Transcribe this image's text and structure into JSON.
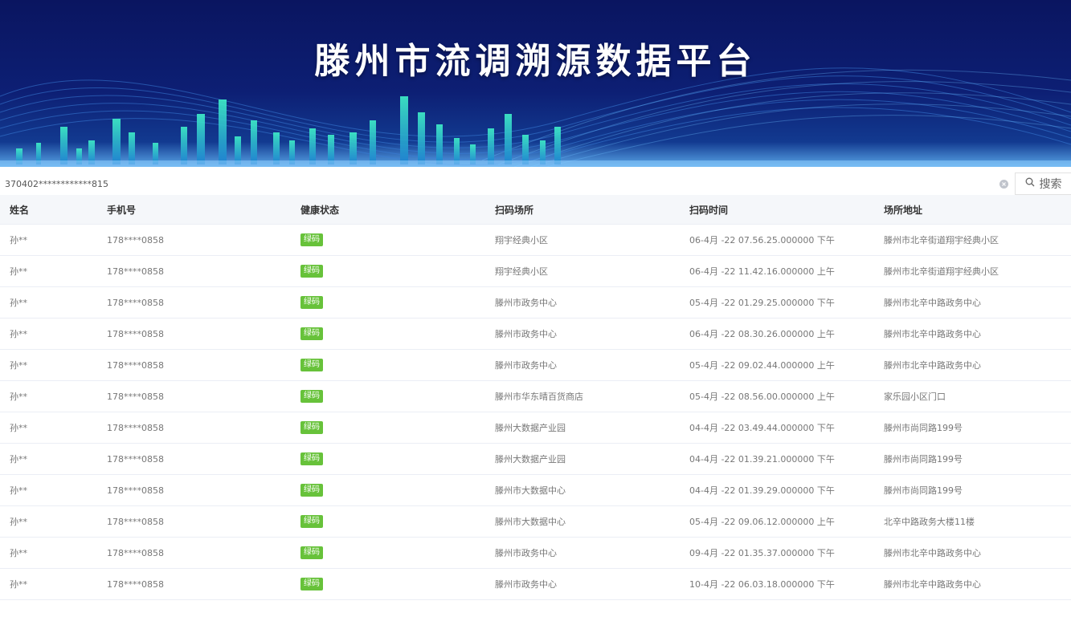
{
  "banner": {
    "title": "滕州市流调溯源数据平台"
  },
  "search": {
    "value": "370402************815",
    "button_label": "搜索"
  },
  "table": {
    "columns": [
      "姓名",
      "手机号",
      "健康状态",
      "扫码场所",
      "扫码时间",
      "场所地址"
    ],
    "rows": [
      {
        "name": "孙**",
        "phone": "178****0858",
        "status": "绿码",
        "place": "翔宇经典小区",
        "time": "06-4月 -22 07.56.25.000000 下午",
        "address": "滕州市北辛街道翔宇经典小区"
      },
      {
        "name": "孙**",
        "phone": "178****0858",
        "status": "绿码",
        "place": "翔宇经典小区",
        "time": "06-4月 -22 11.42.16.000000 上午",
        "address": "滕州市北辛街道翔宇经典小区"
      },
      {
        "name": "孙**",
        "phone": "178****0858",
        "status": "绿码",
        "place": "滕州市政务中心",
        "time": "05-4月 -22 01.29.25.000000 下午",
        "address": "滕州市北辛中路政务中心"
      },
      {
        "name": "孙**",
        "phone": "178****0858",
        "status": "绿码",
        "place": "滕州市政务中心",
        "time": "06-4月 -22 08.30.26.000000 上午",
        "address": "滕州市北辛中路政务中心"
      },
      {
        "name": "孙**",
        "phone": "178****0858",
        "status": "绿码",
        "place": "滕州市政务中心",
        "time": "05-4月 -22 09.02.44.000000 上午",
        "address": "滕州市北辛中路政务中心"
      },
      {
        "name": "孙**",
        "phone": "178****0858",
        "status": "绿码",
        "place": "滕州市华东晴百货商店",
        "time": "05-4月 -22 08.56.00.000000 上午",
        "address": "家乐园小区门口"
      },
      {
        "name": "孙**",
        "phone": "178****0858",
        "status": "绿码",
        "place": "滕州大数据产业园",
        "time": "04-4月 -22 03.49.44.000000 下午",
        "address": "滕州市尚同路199号"
      },
      {
        "name": "孙**",
        "phone": "178****0858",
        "status": "绿码",
        "place": "滕州大数据产业园",
        "time": "04-4月 -22 01.39.21.000000 下午",
        "address": "滕州市尚同路199号"
      },
      {
        "name": "孙**",
        "phone": "178****0858",
        "status": "绿码",
        "place": "滕州市大数据中心",
        "time": "04-4月 -22 01.39.29.000000 下午",
        "address": "滕州市尚同路199号"
      },
      {
        "name": "孙**",
        "phone": "178****0858",
        "status": "绿码",
        "place": "滕州市大数据中心",
        "time": "05-4月 -22 09.06.12.000000 上午",
        "address": "北辛中路政务大楼11楼"
      },
      {
        "name": "孙**",
        "phone": "178****0858",
        "status": "绿码",
        "place": "滕州市政务中心",
        "time": "09-4月 -22 01.35.37.000000 下午",
        "address": "滕州市北辛中路政务中心"
      },
      {
        "name": "孙**",
        "phone": "178****0858",
        "status": "绿码",
        "place": "滕州市政务中心",
        "time": "10-4月 -22 06.03.18.000000 下午",
        "address": "滕州市北辛中路政务中心"
      }
    ]
  },
  "colors": {
    "banner_bg": "#0d1f74",
    "status_green": "#67c23a",
    "skyline": "#2fd3b0"
  }
}
